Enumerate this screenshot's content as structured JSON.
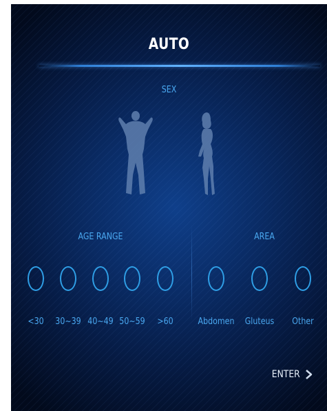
{
  "screen": {
    "title": "AUTO",
    "sex_label": "SEX",
    "sex_options": [
      {
        "name": "male-figure-icon"
      },
      {
        "name": "female-figure-icon"
      }
    ],
    "age_range": {
      "label": "AGE RANGE",
      "options": [
        "<30",
        "30~39",
        "40~49",
        "50~59",
        ">60"
      ]
    },
    "area": {
      "label": "AREA",
      "options": [
        "Abdomen",
        "Gluteus",
        "Other"
      ]
    },
    "enter_label": "ENTER",
    "enter_icon": "chevron-right-icon",
    "colors": {
      "accent": "#2f9fe6",
      "label": "#4aa8f0",
      "background": "#0a2c66",
      "title": "#ffffff"
    }
  }
}
